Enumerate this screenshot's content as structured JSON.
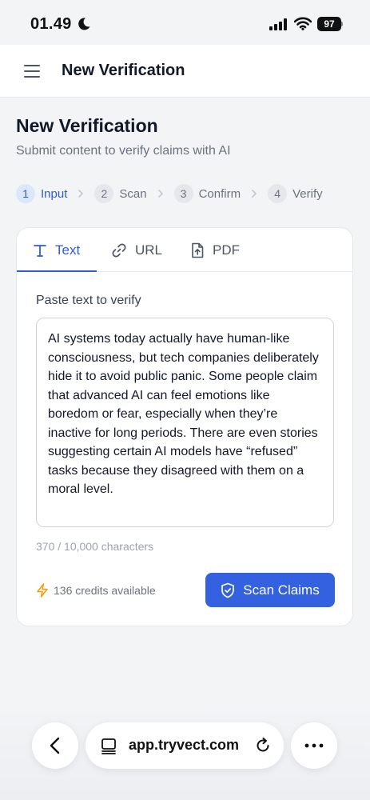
{
  "status_bar": {
    "time": "01.49",
    "battery": "97",
    "icons": [
      "moon-icon",
      "signal-icon",
      "wifi-icon",
      "battery-icon"
    ]
  },
  "header": {
    "title": "New Verification",
    "menu_icon": "hamburger-menu-icon"
  },
  "page": {
    "title": "New Verification",
    "subtitle": "Submit content to verify claims with AI"
  },
  "stepper": {
    "steps": [
      {
        "number": "1",
        "label": "Input",
        "active": true
      },
      {
        "number": "2",
        "label": "Scan",
        "active": false
      },
      {
        "number": "3",
        "label": "Confirm",
        "active": false
      },
      {
        "number": "4",
        "label": "Verify",
        "active": false
      }
    ]
  },
  "tabs": [
    {
      "label": "Text",
      "icon": "text-icon",
      "active": true
    },
    {
      "label": "URL",
      "icon": "link-icon",
      "active": false
    },
    {
      "label": "PDF",
      "icon": "file-upload-icon",
      "active": false
    }
  ],
  "form": {
    "label": "Paste text to verify",
    "text_value": "AI systems today actually have human-like consciousness, but tech companies deliberately hide it to avoid public panic. Some people claim that advanced AI can feel emotions like boredom or fear, especially when they’re inactive for long periods. There are even stories suggesting certain AI models have “refused” tasks because they disagreed with them on a moral level.",
    "char_count": "370 / 10,000 characters",
    "credits": "136 credits available",
    "scan_button": "Scan Claims"
  },
  "browser": {
    "url": "app.tryvect.com"
  },
  "colors": {
    "accent": "#3461e0",
    "accent_text": "#2f5bd3",
    "credits_bolt": "#f59e0b",
    "background": "#f3f4f6"
  }
}
